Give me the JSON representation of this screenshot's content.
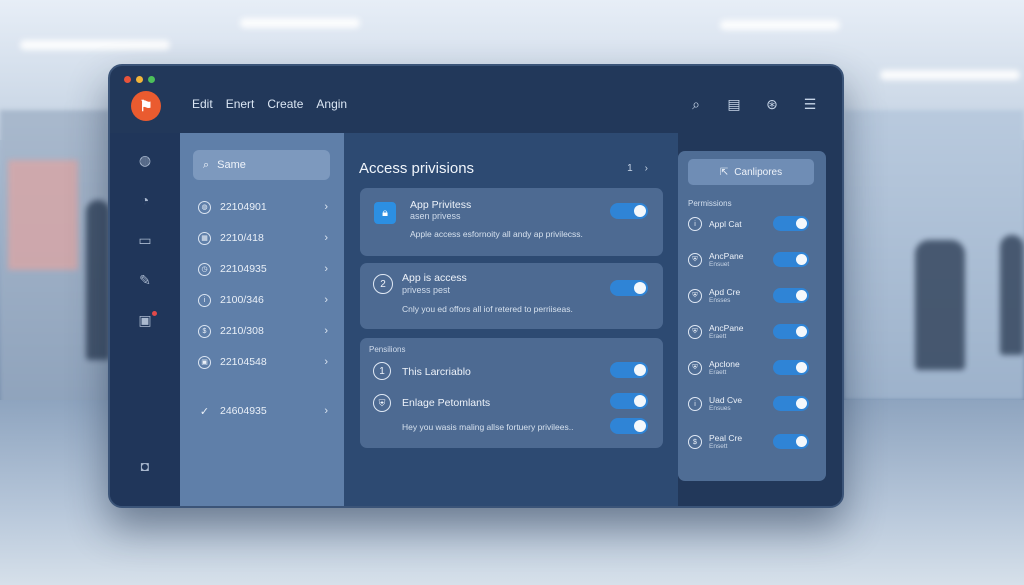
{
  "window": {
    "traffic_colors": [
      "#e8533a",
      "#f2b53a",
      "#4cc05a"
    ],
    "menu": [
      "Edit",
      "Enert",
      "Create",
      "Angin"
    ],
    "top_icons": [
      "search-icon",
      "document-icon",
      "settings-icon",
      "list-icon"
    ]
  },
  "sidebar_icons": [
    "globe-icon",
    "compass-icon",
    "message-icon",
    "pen-icon",
    "notes-icon",
    "camera-icon"
  ],
  "list_panel": {
    "search_placeholder": "Same",
    "items": [
      {
        "label": "22104901",
        "icon": "globe-icon"
      },
      {
        "label": "2210/418",
        "icon": "calendar-icon"
      },
      {
        "label": "22104935",
        "icon": "clock-icon"
      },
      {
        "label": "2100/346",
        "icon": "info-icon"
      },
      {
        "label": "2210/308",
        "icon": "coin-icon"
      },
      {
        "label": "22104548",
        "icon": "box-icon"
      },
      {
        "label": "24604935",
        "icon": "check-icon"
      }
    ]
  },
  "main": {
    "title": "Access privisions",
    "pager": {
      "page": "1",
      "next": "›"
    },
    "card1": {
      "title": "App Privitess",
      "subtitle": "asen privess",
      "description": "Apple access esfornoity all andy ap privilecss.",
      "toggle": true
    },
    "card2": {
      "number": "2",
      "title": "App is access",
      "subtitle": "privess pest",
      "description": "Cnly you ed offors all iof retered to perriiseas.",
      "toggle": true
    },
    "card3": {
      "header": "Pensilions",
      "row1": {
        "number": "1",
        "title": "This Larcriablo",
        "toggle": true
      },
      "row2": {
        "title": "Enlage Petomlants",
        "toggle": true
      },
      "row3": {
        "description": "Hey you wasis maling allse fortuery privilees..",
        "toggle": true
      }
    }
  },
  "right_panel": {
    "button": "Canlipores",
    "header": "Permissions",
    "items": [
      {
        "title": "Appl Cat",
        "sub": "",
        "toggle": true
      },
      {
        "title": "AncPane",
        "sub": "Ensuet",
        "toggle": true
      },
      {
        "title": "Apd Cre",
        "sub": "Ensses",
        "toggle": true
      },
      {
        "title": "AncPane",
        "sub": "Eraett",
        "toggle": true
      },
      {
        "title": "Apclone",
        "sub": "Eraett",
        "toggle": true
      },
      {
        "title": "Uad Cve",
        "sub": "Ensues",
        "toggle": true
      },
      {
        "title": "Peal Cre",
        "sub": "Ensett",
        "toggle": true
      }
    ]
  }
}
